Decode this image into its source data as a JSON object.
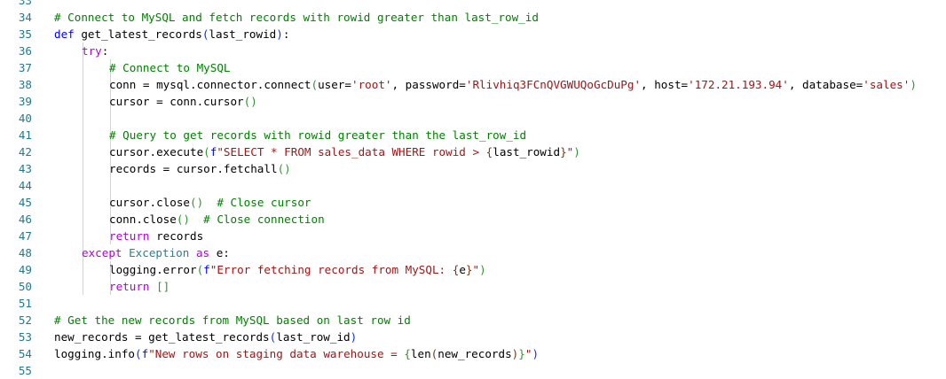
{
  "editor": {
    "lines": [
      {
        "num": "33",
        "indent": 0,
        "tokens": []
      },
      {
        "num": "34",
        "indent": 0,
        "tokens": [
          {
            "t": "# Connect to MySQL and fetch records with rowid greater than last_row_id",
            "c": "cm"
          }
        ]
      },
      {
        "num": "35",
        "indent": 0,
        "tokens": [
          {
            "t": "def",
            "c": "kw"
          },
          {
            "t": " get_latest_records",
            "c": "fn"
          },
          {
            "t": "(",
            "c": "br1"
          },
          {
            "t": "last_rowid",
            "c": "pl"
          },
          {
            "t": ")",
            "c": "br1"
          },
          {
            "t": ":",
            "c": "pl"
          }
        ]
      },
      {
        "num": "36",
        "indent": 1,
        "tokens": [
          {
            "t": "try",
            "c": "ctl"
          },
          {
            "t": ":",
            "c": "pl"
          }
        ]
      },
      {
        "num": "37",
        "indent": 2,
        "tokens": [
          {
            "t": "# Connect to MySQL",
            "c": "cm"
          }
        ]
      },
      {
        "num": "38",
        "indent": 2,
        "tokens": [
          {
            "t": "conn = mysql.connector.connect",
            "c": "pl"
          },
          {
            "t": "(",
            "c": "br2"
          },
          {
            "t": "user=",
            "c": "pl"
          },
          {
            "t": "'root'",
            "c": "st"
          },
          {
            "t": ", password=",
            "c": "pl"
          },
          {
            "t": "'Rlivhiq3FCnQVGWUQoGcDuPg'",
            "c": "st"
          },
          {
            "t": ", host=",
            "c": "pl"
          },
          {
            "t": "'172.21.193.94'",
            "c": "st"
          },
          {
            "t": ", database=",
            "c": "pl"
          },
          {
            "t": "'sales'",
            "c": "st"
          },
          {
            "t": ")",
            "c": "br2"
          }
        ]
      },
      {
        "num": "39",
        "indent": 2,
        "tokens": [
          {
            "t": "cursor = conn.cursor",
            "c": "pl"
          },
          {
            "t": "()",
            "c": "br2"
          }
        ]
      },
      {
        "num": "40",
        "indent": 2,
        "tokens": []
      },
      {
        "num": "41",
        "indent": 2,
        "tokens": [
          {
            "t": "# Query to get records with rowid greater than the last_row_id",
            "c": "cm"
          }
        ]
      },
      {
        "num": "42",
        "indent": 2,
        "tokens": [
          {
            "t": "cursor.execute",
            "c": "pl"
          },
          {
            "t": "(",
            "c": "br2"
          },
          {
            "t": "f",
            "c": "kw"
          },
          {
            "t": "\"SELECT * FROM sales_data WHERE rowid > ",
            "c": "st"
          },
          {
            "t": "{",
            "c": "br3"
          },
          {
            "t": "last_rowid",
            "c": "pl"
          },
          {
            "t": "}",
            "c": "br3"
          },
          {
            "t": "\"",
            "c": "st"
          },
          {
            "t": ")",
            "c": "br2"
          }
        ]
      },
      {
        "num": "43",
        "indent": 2,
        "tokens": [
          {
            "t": "records = cursor.fetchall",
            "c": "pl"
          },
          {
            "t": "()",
            "c": "br2"
          }
        ]
      },
      {
        "num": "44",
        "indent": 2,
        "tokens": []
      },
      {
        "num": "45",
        "indent": 2,
        "tokens": [
          {
            "t": "cursor.close",
            "c": "pl"
          },
          {
            "t": "()",
            "c": "br2"
          },
          {
            "t": "  ",
            "c": "pl"
          },
          {
            "t": "# Close cursor",
            "c": "cm"
          }
        ]
      },
      {
        "num": "46",
        "indent": 2,
        "tokens": [
          {
            "t": "conn.close",
            "c": "pl"
          },
          {
            "t": "()",
            "c": "br2"
          },
          {
            "t": "  ",
            "c": "pl"
          },
          {
            "t": "# Close connection",
            "c": "cm"
          }
        ]
      },
      {
        "num": "47",
        "indent": 2,
        "tokens": [
          {
            "t": "return",
            "c": "ctl"
          },
          {
            "t": " records",
            "c": "pl"
          }
        ]
      },
      {
        "num": "48",
        "indent": 1,
        "tokens": [
          {
            "t": "except",
            "c": "ctl"
          },
          {
            "t": " ",
            "c": "pl"
          },
          {
            "t": "Exception",
            "c": "cls"
          },
          {
            "t": " ",
            "c": "pl"
          },
          {
            "t": "as",
            "c": "ctl"
          },
          {
            "t": " e:",
            "c": "pl"
          }
        ]
      },
      {
        "num": "49",
        "indent": 2,
        "tokens": [
          {
            "t": "logging.error",
            "c": "pl"
          },
          {
            "t": "(",
            "c": "br2"
          },
          {
            "t": "f",
            "c": "kw"
          },
          {
            "t": "\"Error fetching records from MySQL: ",
            "c": "st"
          },
          {
            "t": "{",
            "c": "br3"
          },
          {
            "t": "e",
            "c": "pl"
          },
          {
            "t": "}",
            "c": "br3"
          },
          {
            "t": "\"",
            "c": "st"
          },
          {
            "t": ")",
            "c": "br2"
          }
        ]
      },
      {
        "num": "50",
        "indent": 2,
        "tokens": [
          {
            "t": "return",
            "c": "ctl"
          },
          {
            "t": " ",
            "c": "pl"
          },
          {
            "t": "[]",
            "c": "br2"
          }
        ]
      },
      {
        "num": "51",
        "indent": 0,
        "tokens": []
      },
      {
        "num": "52",
        "indent": 0,
        "tokens": [
          {
            "t": "# Get the new records from MySQL based on last row id",
            "c": "cm"
          }
        ]
      },
      {
        "num": "53",
        "indent": 0,
        "tokens": [
          {
            "t": "new_records = get_latest_records",
            "c": "pl"
          },
          {
            "t": "(",
            "c": "br1"
          },
          {
            "t": "last_row_id",
            "c": "pl"
          },
          {
            "t": ")",
            "c": "br1"
          }
        ]
      },
      {
        "num": "54",
        "indent": 0,
        "tokens": [
          {
            "t": "logging.info",
            "c": "pl"
          },
          {
            "t": "(",
            "c": "br1"
          },
          {
            "t": "f",
            "c": "kw"
          },
          {
            "t": "\"New rows on staging data warehouse = ",
            "c": "st"
          },
          {
            "t": "{",
            "c": "br2"
          },
          {
            "t": "len",
            "c": "pl"
          },
          {
            "t": "(",
            "c": "br3"
          },
          {
            "t": "new_records",
            "c": "pl"
          },
          {
            "t": ")",
            "c": "br3"
          },
          {
            "t": "}",
            "c": "br2"
          },
          {
            "t": "\"",
            "c": "st"
          },
          {
            "t": ")",
            "c": "br1"
          }
        ]
      },
      {
        "num": "55",
        "indent": 0,
        "tokens": []
      }
    ]
  }
}
